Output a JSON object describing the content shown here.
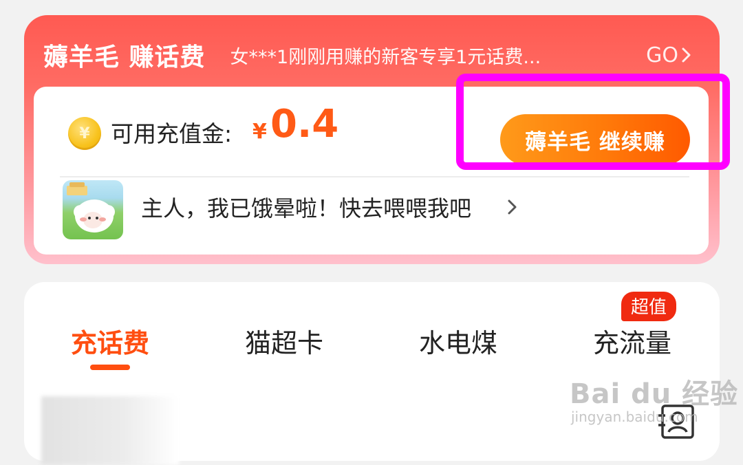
{
  "promo": {
    "title": "薅羊毛 赚话费",
    "ticker": "女***1刚刚用赚的新客专享1元话费...",
    "go_label": "GO"
  },
  "balance": {
    "coin_symbol": "¥",
    "label": "可用充值金:",
    "currency": "¥",
    "value": "0.4"
  },
  "earn_button": {
    "label": "薅羊毛 继续赚"
  },
  "sheep_game": {
    "text": "主人，我已饿晕啦！快去喂喂我吧"
  },
  "tabs": [
    {
      "label": "充话费",
      "active": true
    },
    {
      "label": "猫超卡",
      "active": false
    },
    {
      "label": "水电煤",
      "active": false
    },
    {
      "label": "充流量",
      "active": false
    }
  ],
  "flow_badge": "超值",
  "watermark": {
    "brand": "Bai du 经验",
    "site": "jingyan.baidu.com"
  },
  "colors": {
    "accent": "#ff4e10",
    "promo_red": "#ff5a52",
    "button_orange": "#ff7a0a",
    "highlight": "#ff00ff",
    "badge_red": "#f02a10"
  },
  "icons": [
    "coin-icon",
    "chevron-right-icon",
    "contacts-icon",
    "sheep-game-icon"
  ]
}
